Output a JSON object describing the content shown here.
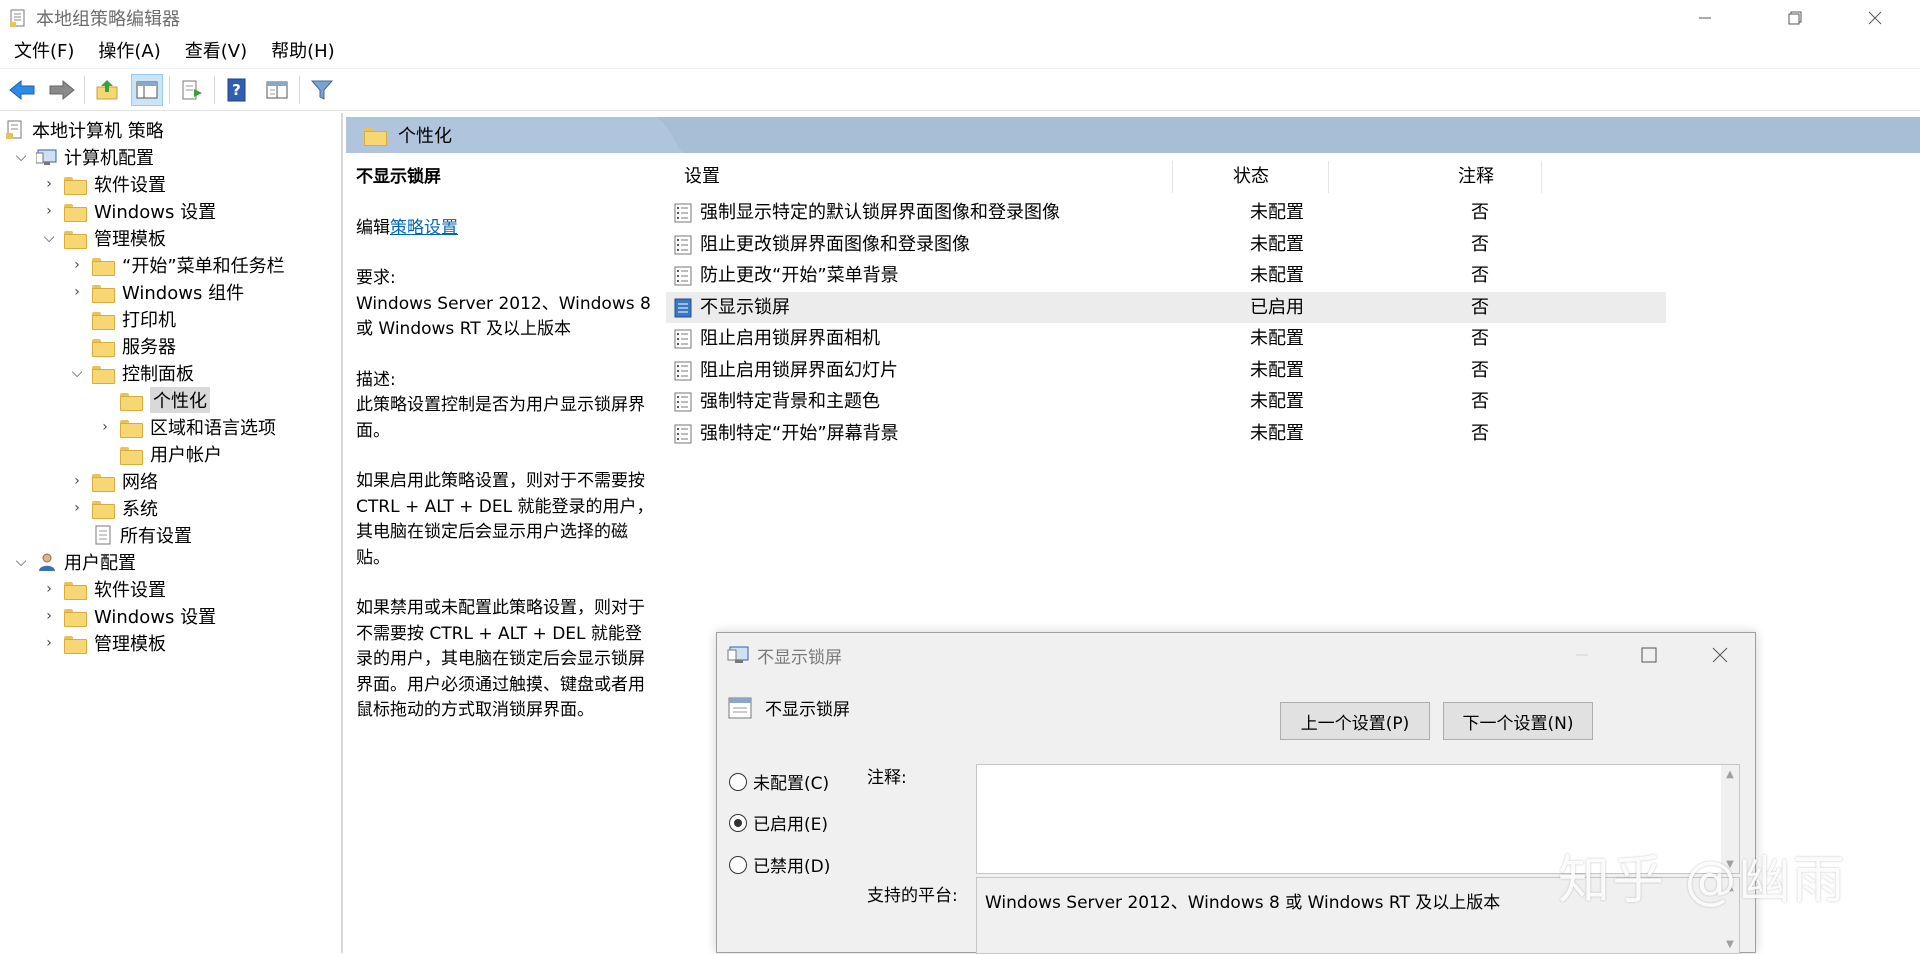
{
  "window": {
    "title": "本地组策略编辑器",
    "buttons": {
      "minimize": "—",
      "maximize": "❐",
      "close": "✕"
    }
  },
  "menu": [
    "文件(F)",
    "操作(A)",
    "查看(V)",
    "帮助(H)"
  ],
  "toolbar_icons": [
    "back-arrow-icon",
    "forward-arrow-icon",
    "up-folder-icon",
    "show-hide-tree-icon",
    "export-list-icon",
    "help-icon",
    "properties-icon",
    "filter-icon"
  ],
  "tree": [
    {
      "label": "本地计算机 策略",
      "icon": "computer-policy-icon",
      "level": 0,
      "chev": ""
    },
    {
      "label": "计算机配置",
      "icon": "computer-icon",
      "level": 1,
      "chev": "⌄"
    },
    {
      "label": "软件设置",
      "icon": "folder-icon",
      "level": 2,
      "chev": "›"
    },
    {
      "label": "Windows 设置",
      "icon": "folder-icon",
      "level": 2,
      "chev": "›"
    },
    {
      "label": "管理模板",
      "icon": "folder-icon",
      "level": 2,
      "chev": "⌄"
    },
    {
      "label": "“开始”菜单和任务栏",
      "icon": "folder-icon",
      "level": 3,
      "chev": "›"
    },
    {
      "label": "Windows 组件",
      "icon": "folder-icon",
      "level": 3,
      "chev": "›"
    },
    {
      "label": "打印机",
      "icon": "folder-icon",
      "level": 3,
      "chev": ""
    },
    {
      "label": "服务器",
      "icon": "folder-icon",
      "level": 3,
      "chev": ""
    },
    {
      "label": "控制面板",
      "icon": "folder-icon",
      "level": 3,
      "chev": "⌄"
    },
    {
      "label": "个性化",
      "icon": "folder-icon",
      "level": 4,
      "chev": "",
      "selected": true
    },
    {
      "label": "区域和语言选项",
      "icon": "folder-icon",
      "level": 4,
      "chev": "›"
    },
    {
      "label": "用户帐户",
      "icon": "folder-icon",
      "level": 4,
      "chev": ""
    },
    {
      "label": "网络",
      "icon": "folder-icon",
      "level": 3,
      "chev": "›"
    },
    {
      "label": "系统",
      "icon": "folder-icon",
      "level": 3,
      "chev": "›"
    },
    {
      "label": "所有设置",
      "icon": "all-settings-icon",
      "level": 3,
      "chev": ""
    },
    {
      "label": "用户配置",
      "icon": "user-icon",
      "level": 1,
      "chev": "⌄"
    },
    {
      "label": "软件设置",
      "icon": "folder-icon",
      "level": 2,
      "chev": "›"
    },
    {
      "label": "Windows 设置",
      "icon": "folder-icon",
      "level": 2,
      "chev": "›"
    },
    {
      "label": "管理模板",
      "icon": "folder-icon",
      "level": 2,
      "chev": "›"
    }
  ],
  "content": {
    "header": "个性化",
    "desc": {
      "title": "不显示锁屏",
      "edit_prefix": "编辑",
      "edit_link": "策略设置",
      "req_label": "要求:",
      "req_text": "Windows Server 2012、Windows 8 或 Windows RT 及以上版本",
      "desc_label": "描述:",
      "desc_text": "此策略设置控制是否为用户显示锁屏界面。",
      "enabled_text": "如果启用此策略设置，则对于不需要按 CTRL + ALT + DEL  就能登录的用户，其电脑在锁定后会显示用户选择的磁贴。",
      "disabled_text": "如果禁用或未配置此策略设置，则对于不需要按 CTRL + ALT + DEL 就能登录的用户，其电脑在锁定后会显示锁屏界面。用户必须通过触摸、键盘或者用鼠标拖动的方式取消锁屏界面。"
    },
    "table": {
      "columns": [
        "设置",
        "状态",
        "注释"
      ],
      "rows": [
        {
          "name": "强制显示特定的默认锁屏界面图像和登录图像",
          "state": "未配置",
          "comment": "否"
        },
        {
          "name": "阻止更改锁屏界面图像和登录图像",
          "state": "未配置",
          "comment": "否"
        },
        {
          "name": "防止更改“开始”菜单背景",
          "state": "未配置",
          "comment": "否"
        },
        {
          "name": "不显示锁屏",
          "state": "已启用",
          "comment": "否",
          "selected": true
        },
        {
          "name": "阻止启用锁屏界面相机",
          "state": "未配置",
          "comment": "否"
        },
        {
          "name": "阻止启用锁屏界面幻灯片",
          "state": "未配置",
          "comment": "否"
        },
        {
          "name": "强制特定背景和主题色",
          "state": "未配置",
          "comment": "否"
        },
        {
          "name": "强制特定“开始”屏幕背景",
          "state": "未配置",
          "comment": "否"
        }
      ]
    }
  },
  "dialog": {
    "title": "不显示锁屏",
    "heading": "不显示锁屏",
    "prev_button": "上一个设置(P)",
    "next_button": "下一个设置(N)",
    "radios": [
      {
        "label": "未配置(C)",
        "checked": false
      },
      {
        "label": "已启用(E)",
        "checked": true
      },
      {
        "label": "已禁用(D)",
        "checked": false
      }
    ],
    "comment_label": "注释:",
    "comment_value": "",
    "platform_label": "支持的平台:",
    "platform_value": "Windows Server 2012、Windows 8 或 Windows RT 及以上版本"
  },
  "watermark": "知乎 @幽雨"
}
